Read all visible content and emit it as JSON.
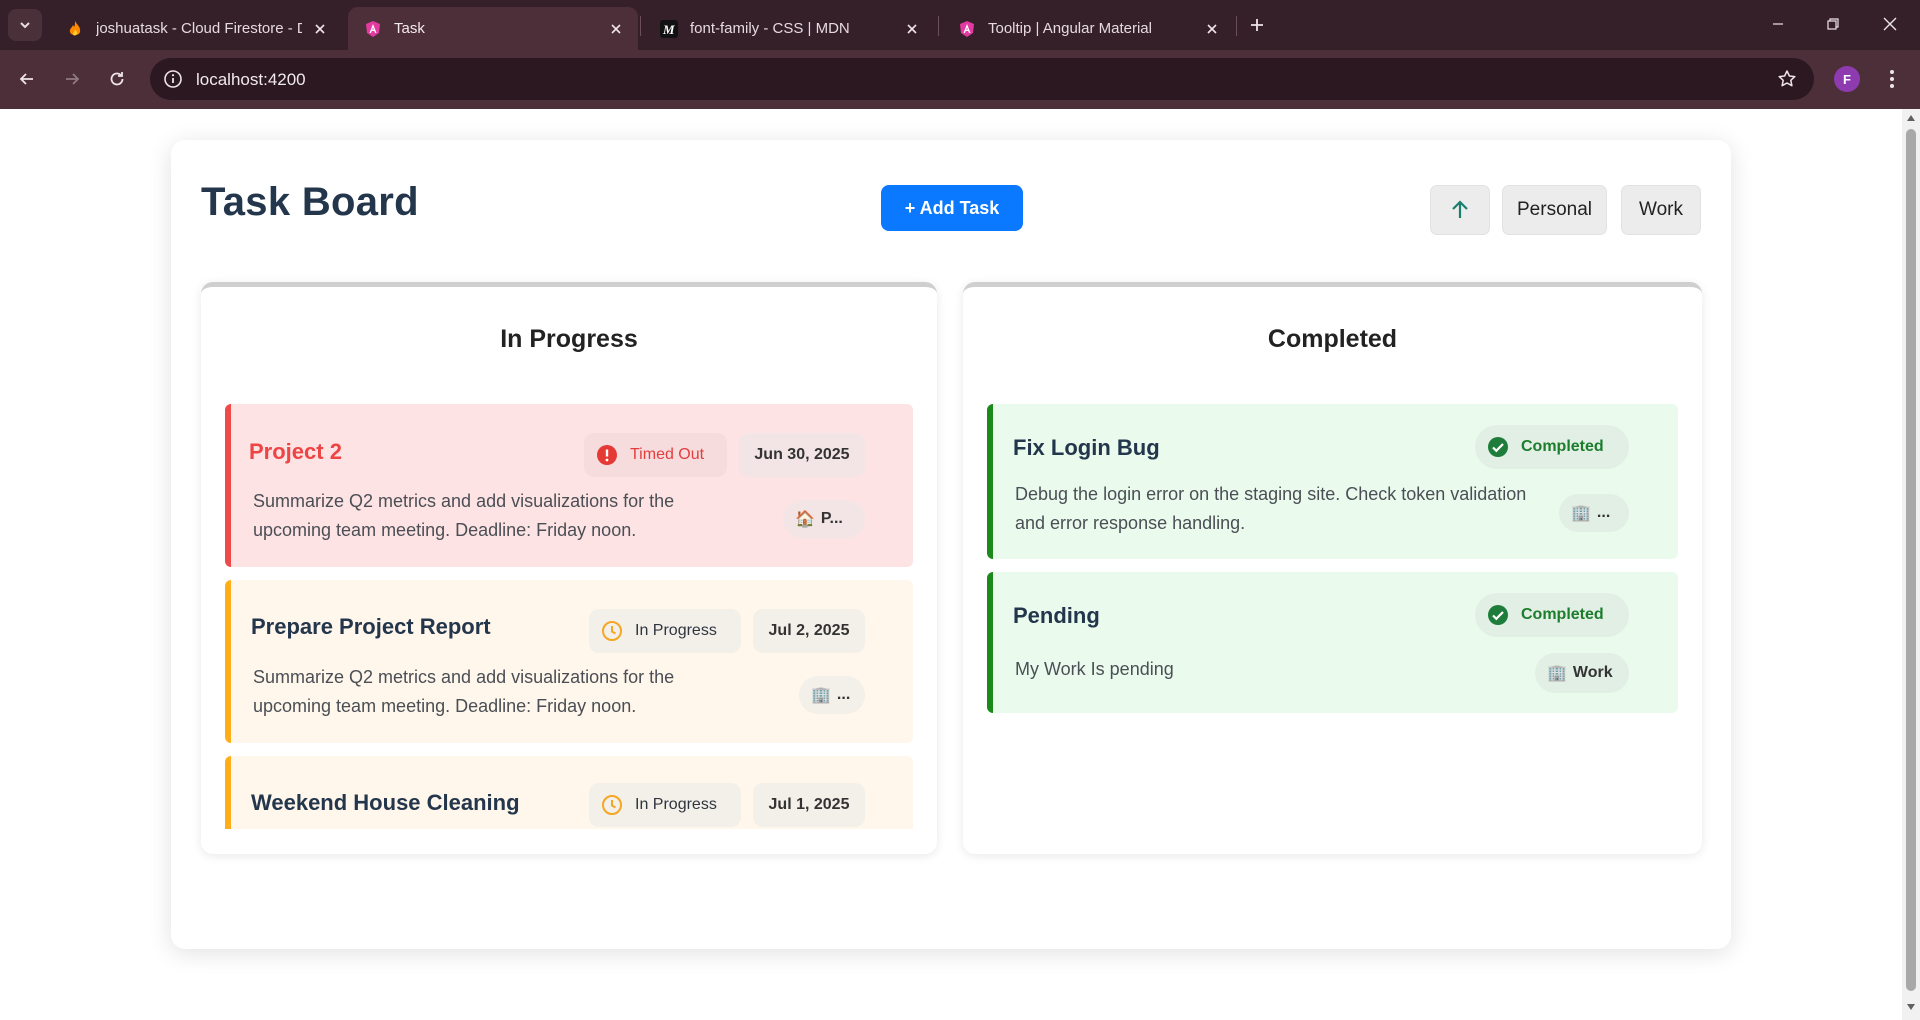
{
  "browser": {
    "tabs": [
      {
        "title": "joshuatask - Cloud Firestore - D",
        "icon": "firebase-icon"
      },
      {
        "title": "Task",
        "icon": "angular-icon",
        "active": true
      },
      {
        "title": "font-family - CSS | MDN",
        "icon": "mdn-icon"
      },
      {
        "title": "Tooltip | Angular Material",
        "icon": "angular-icon"
      }
    ],
    "url": "localhost:4200",
    "profile_initial": "F"
  },
  "page": {
    "title": "Task Board",
    "add_task_label": "+ Add Task",
    "filters": [
      "Personal",
      "Work"
    ]
  },
  "columns": [
    {
      "title": "In Progress",
      "cards": [
        {
          "title": "Project 2",
          "status": "Timed Out",
          "date": "Jun 30, 2025",
          "description": "Summarize Q2 metrics and add visualizations for the upcoming team meeting. Deadline: Friday noon.",
          "category_emoji": "🏠",
          "category": "P..."
        },
        {
          "title": "Prepare Project Report",
          "status": "In Progress",
          "date": "Jul 2, 2025",
          "description": "Summarize Q2 metrics and add visualizations for the upcoming team meeting. Deadline: Friday noon.",
          "category_emoji": "🏢",
          "category": "..."
        },
        {
          "title": "Weekend House Cleaning",
          "status": "In Progress",
          "date": "Jul 1, 2025"
        }
      ]
    },
    {
      "title": "Completed",
      "cards": [
        {
          "title": "Fix Login Bug",
          "status": "Completed",
          "description": "Debug the login error on the staging site. Check token validation and error response handling.",
          "category_emoji": "🏢",
          "category": "..."
        },
        {
          "title": "Pending",
          "status": "Completed",
          "description": "My Work Is pending",
          "category_emoji": "🏢",
          "category": "Work"
        }
      ]
    }
  ],
  "colors": {
    "accent": "#0a79ff",
    "timed_out": "#ef4a4a",
    "in_progress": "#ffae1a",
    "completed": "#1b8a1b",
    "title_text": "#23364b"
  }
}
